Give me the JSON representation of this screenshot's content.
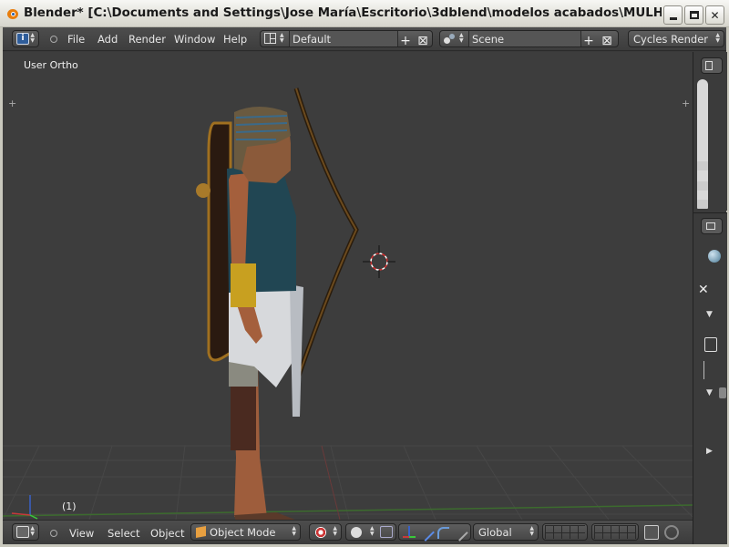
{
  "window": {
    "title": "Blender* [C:\\Documents and Settings\\Jose María\\Escritorio\\3dblend\\modelos acabados\\MULHORAND\\skuld gua...",
    "minimize_icon": "minimize-icon",
    "maximize_icon": "maximize-icon",
    "close_glyph": "✕"
  },
  "info_header": {
    "menus": [
      "File",
      "Add",
      "Render",
      "Window",
      "Help"
    ],
    "screen_layout": "Default",
    "scene": "Scene",
    "render_engine": "Cycles Render"
  },
  "viewport": {
    "view_name": "User Ortho",
    "frame": "(1)"
  },
  "view_header": {
    "menus": [
      "View",
      "Select",
      "Object"
    ],
    "mode": "Object Mode",
    "transform_orientation": "Global"
  },
  "colors": {
    "header_bg": "#464646",
    "viewport_bg": "#3d3d3d",
    "grid_line": "#4a4a4a",
    "x_axis": "#7a3a3a",
    "y_axis": "#3f7a2f",
    "accent": "#e87d0d"
  }
}
